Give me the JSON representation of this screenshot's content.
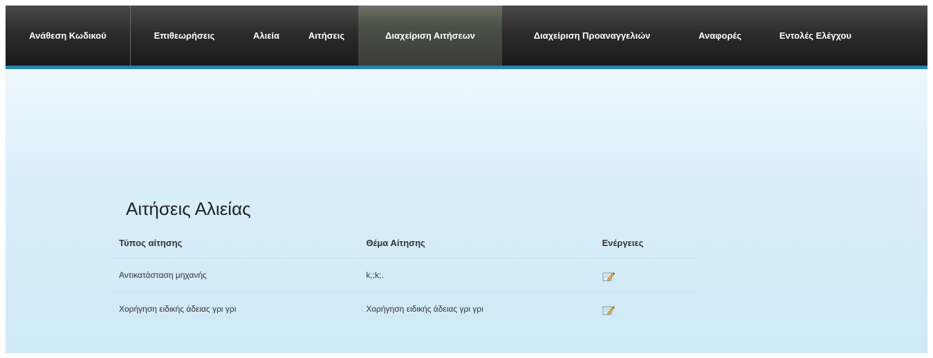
{
  "nav": {
    "items": [
      {
        "label": "Ανάθεση Κωδικού"
      },
      {
        "label": "Επιθεωρήσεις"
      },
      {
        "label": "Αλιεία"
      },
      {
        "label": "Αιτήσεις"
      },
      {
        "label": "Διαχείριση Αιτήσεων",
        "active": true
      },
      {
        "label": "Διαχείριση Προαναγγελιών"
      },
      {
        "label": "Αναφορές"
      },
      {
        "label": "Εντολές Ελέγχου"
      }
    ]
  },
  "main": {
    "title": "Αιτήσεις Αλιείας",
    "table": {
      "headers": [
        "Τύπος αίτησης",
        "Θέμα Αίτησης",
        "Ενέργειες"
      ],
      "rows": [
        {
          "type": "Αντικατάσταση μηχανής",
          "subject": "k;;k;.",
          "action_icon": "edit-icon"
        },
        {
          "type": "Χορήγηση ειδικής άδειας γρι γρι",
          "subject": "Χορήγηση ειδικής άδειας γρι γρι",
          "action_icon": "edit-icon"
        }
      ]
    }
  },
  "colors": {
    "nav_bg": "#1a1a1a",
    "nav_active": "#4b5046",
    "accent": "#1f86b8",
    "page_bg": "#d9eef9"
  }
}
